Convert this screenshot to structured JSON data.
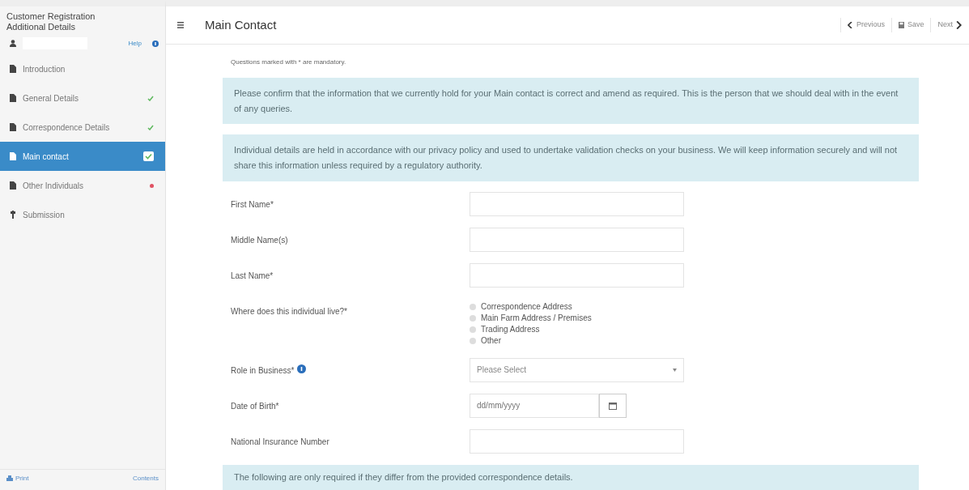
{
  "sidebar": {
    "title": "Customer Registration Additional Details",
    "help": "Help",
    "items": [
      {
        "label": "Introduction",
        "kind": "page",
        "done": false,
        "error": false,
        "selected": false
      },
      {
        "label": "General Details",
        "kind": "page",
        "done": true,
        "error": false,
        "selected": false
      },
      {
        "label": "Correspondence Details",
        "kind": "page",
        "done": true,
        "error": false,
        "selected": false
      },
      {
        "label": "Main contact",
        "kind": "page",
        "done": true,
        "error": false,
        "selected": true
      },
      {
        "label": "Other Individuals",
        "kind": "page",
        "done": false,
        "error": true,
        "selected": false
      },
      {
        "label": "Submission",
        "kind": "flag",
        "done": false,
        "error": false,
        "selected": false
      }
    ],
    "print": "Print",
    "contents": "Contents"
  },
  "header": {
    "title": "Main Contact",
    "buttons": [
      {
        "label": "Previous",
        "kind": "prev"
      },
      {
        "label": "Save",
        "kind": "save"
      },
      {
        "label": "Next",
        "kind": "next"
      }
    ]
  },
  "mandatory_note": "Questions marked with * are mandatory.",
  "alerts": [
    "Please confirm that the information that we currently hold for your Main contact is correct and amend as required. This is the person that we should deal with in the event of any queries.",
    "Individual details are held in accordance with our privacy policy and used to undertake validation checks on your business. We will keep information securely and will not share this information unless required by a regulatory authority."
  ],
  "fields": [
    {
      "label": "First Name*",
      "kind": "text"
    },
    {
      "label": "Middle Name(s)",
      "kind": "text"
    },
    {
      "label": "Last Name*",
      "kind": "text"
    },
    {
      "label": "Where does this individual live?*",
      "kind": "radio",
      "options": [
        {
          "label": "Correspondence Address",
          "selected": false
        },
        {
          "label": "Main Farm Address / Premises",
          "selected": false
        },
        {
          "label": "Trading Address",
          "selected": false
        },
        {
          "label": "Other",
          "selected": false
        }
      ]
    },
    {
      "label": "Role in Business*",
      "kind": "select",
      "help": true,
      "value": "Please Select"
    },
    {
      "label": "Date of Birth*",
      "kind": "date",
      "placeholder": "dd/mm/yyyy"
    },
    {
      "label": "National Insurance Number",
      "kind": "text"
    }
  ],
  "footer_alert": "The following are only required if they differ from the provided correspondence details."
}
